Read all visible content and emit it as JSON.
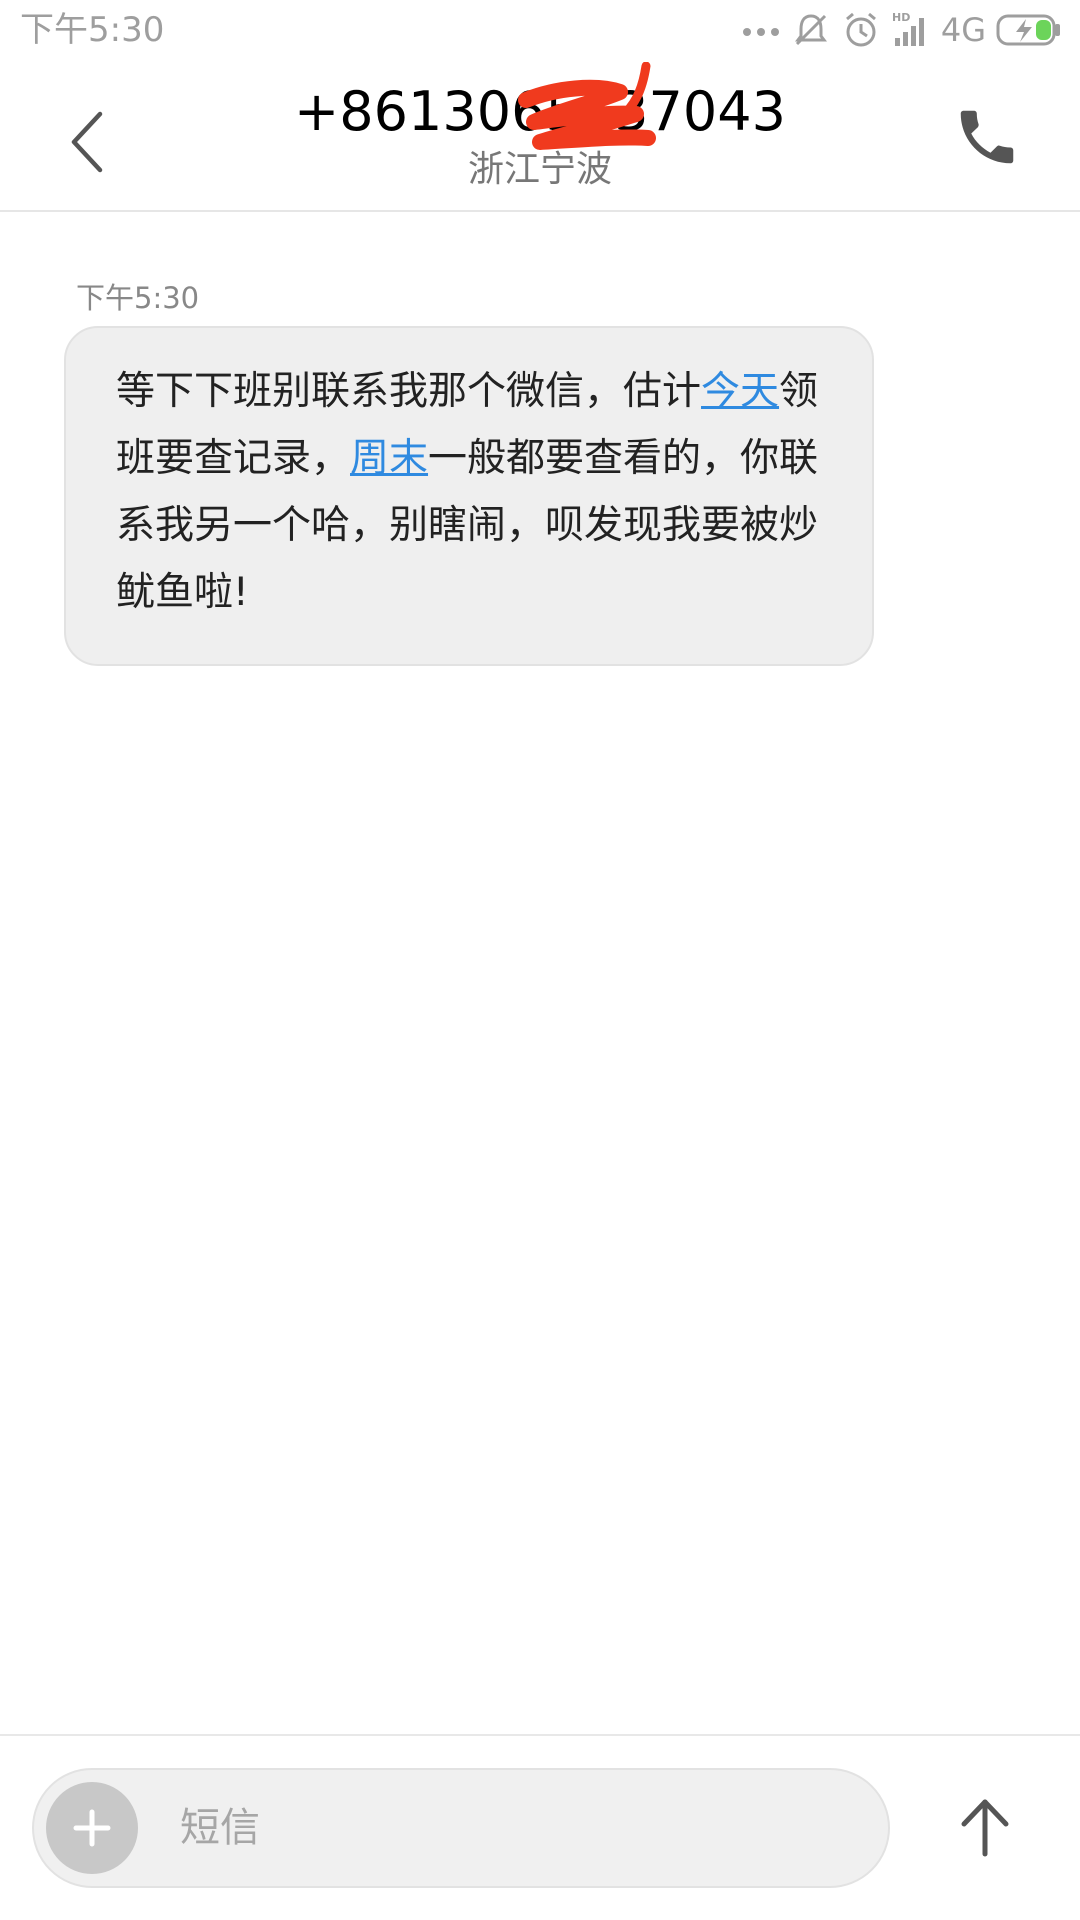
{
  "status_bar": {
    "time": "下午5:30",
    "network": "4G",
    "icons": [
      "more-dots-icon",
      "mute-icon",
      "alarm-icon",
      "hd-signal-icon",
      "battery-charging-icon"
    ]
  },
  "header": {
    "phone_number": "+8613065537043",
    "location": "浙江宁波",
    "icons": [
      "back-arrow-icon",
      "phone-icon"
    ]
  },
  "conversation": {
    "messages": [
      {
        "time": "下午5:30",
        "segments": [
          {
            "text": "等下下班别联系我那个微信，估计",
            "link": false
          },
          {
            "text": "今天",
            "link": true
          },
          {
            "text": "领班要查记录，",
            "link": false
          },
          {
            "text": "周末",
            "link": true
          },
          {
            "text": "一般都要查看的，你联系我另一个哈，别瞎闹，呗发现我要被炒鱿鱼啦!",
            "link": false
          }
        ]
      }
    ]
  },
  "compose": {
    "placeholder": "短信",
    "value": "",
    "icons": [
      "plus-icon",
      "send-arrow-icon"
    ]
  },
  "colors": {
    "link": "#2f8ae0",
    "bubble": "#efefef",
    "secondary_text": "#777777",
    "redaction": "#f03a1e"
  }
}
